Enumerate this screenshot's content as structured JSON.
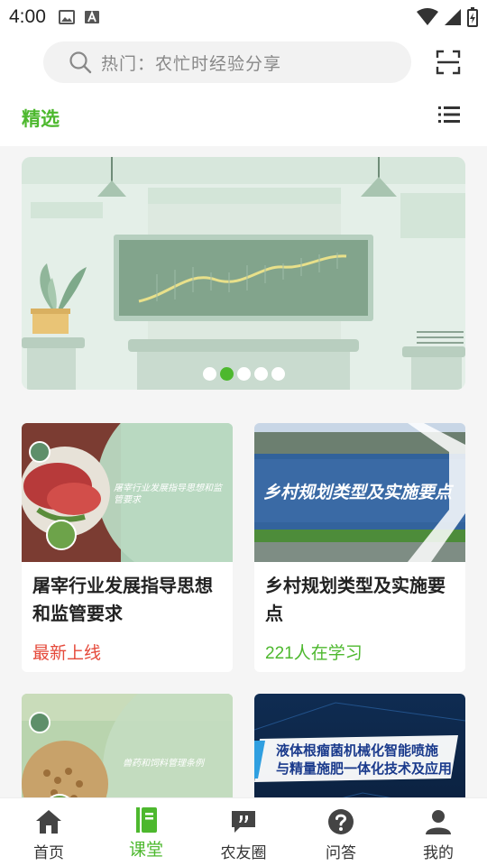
{
  "status_bar": {
    "time": "4:00"
  },
  "search": {
    "placeholder": "热门：农忙时经验分享"
  },
  "tabs": {
    "selected": "精选"
  },
  "banner": {
    "slides": 5,
    "active_slide": 2
  },
  "courses": [
    {
      "title": "屠宰行业发展指导思想和监管要求",
      "meta": "最新上线",
      "meta_type": "red",
      "thumb_text": "屠宰行业发展指导思想和监管要求"
    },
    {
      "title": "乡村规划类型及实施要点",
      "meta": "221人在学习",
      "meta_type": "green",
      "thumb_text": "乡村规划类型及实施要点"
    },
    {
      "title": "",
      "meta": "",
      "thumb_text": "兽药和饲料管理条例"
    },
    {
      "title": "",
      "meta": "",
      "thumb_text_1": "液体根瘤菌机械化智能喷施",
      "thumb_text_2": "与精量施肥一体化技术及应用"
    }
  ],
  "bottom_nav": [
    {
      "label": "首页",
      "icon": "home-icon",
      "active": false
    },
    {
      "label": "课堂",
      "icon": "book-icon",
      "active": true
    },
    {
      "label": "农友圈",
      "icon": "chat-quote-icon",
      "active": false
    },
    {
      "label": "问答",
      "icon": "question-icon",
      "active": false
    },
    {
      "label": "我的",
      "icon": "person-icon",
      "active": false
    }
  ],
  "colors": {
    "accent": "#4db82e",
    "highlight_red": "#e5493a"
  }
}
